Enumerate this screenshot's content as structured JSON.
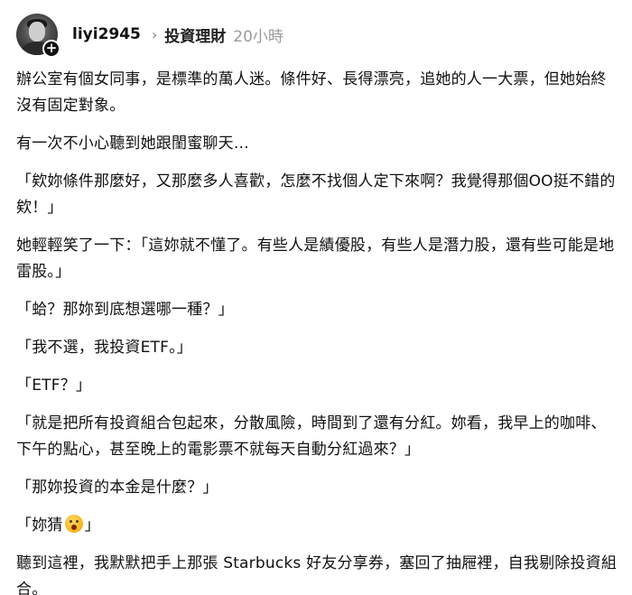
{
  "post": {
    "username": "liyi2945",
    "chevron": "›",
    "category": "投資理財",
    "time": "20小時",
    "avatar_badge": "+",
    "paragraphs": [
      "辦公室有個女同事，是標準的萬人迷。條件好、長得漂亮，追她的人一大票，但她始終沒有固定對象。",
      "有一次不小心聽到她跟閨蜜聊天…",
      "「欸妳條件那麼好，又那麼多人喜歡，怎麼不找個人定下來啊？我覺得那個OO挺不錯的欸！」",
      "她輕輕笑了一下：「這妳就不懂了。有些人是績優股，有些人是潛力股，還有些可能是地雷股。」",
      "「蛤？那妳到底想選哪一種？」",
      "「我不選，我投資ETF。」",
      "「ETF？」",
      "「就是把所有投資組合包起來，分散風險，時間到了還有分紅。妳看，我早上的咖啡、下午的點心，甚至晚上的電影票不就每天自動分紅過來？」",
      "「那妳投資的本金是什麼？」",
      "「妳猜",
      "」",
      "聽到這裡，我默默把手上那張 Starbucks 好友分享券，塞回了抽屜裡，自我剔除投資組合。"
    ]
  },
  "icons": {
    "avatar": "profile-photo",
    "follow": "plus-icon",
    "emoji": "hushed-face-emoji"
  },
  "colors": {
    "text": "#111111",
    "muted": "#9a9a9a",
    "background": "#ffffff"
  }
}
